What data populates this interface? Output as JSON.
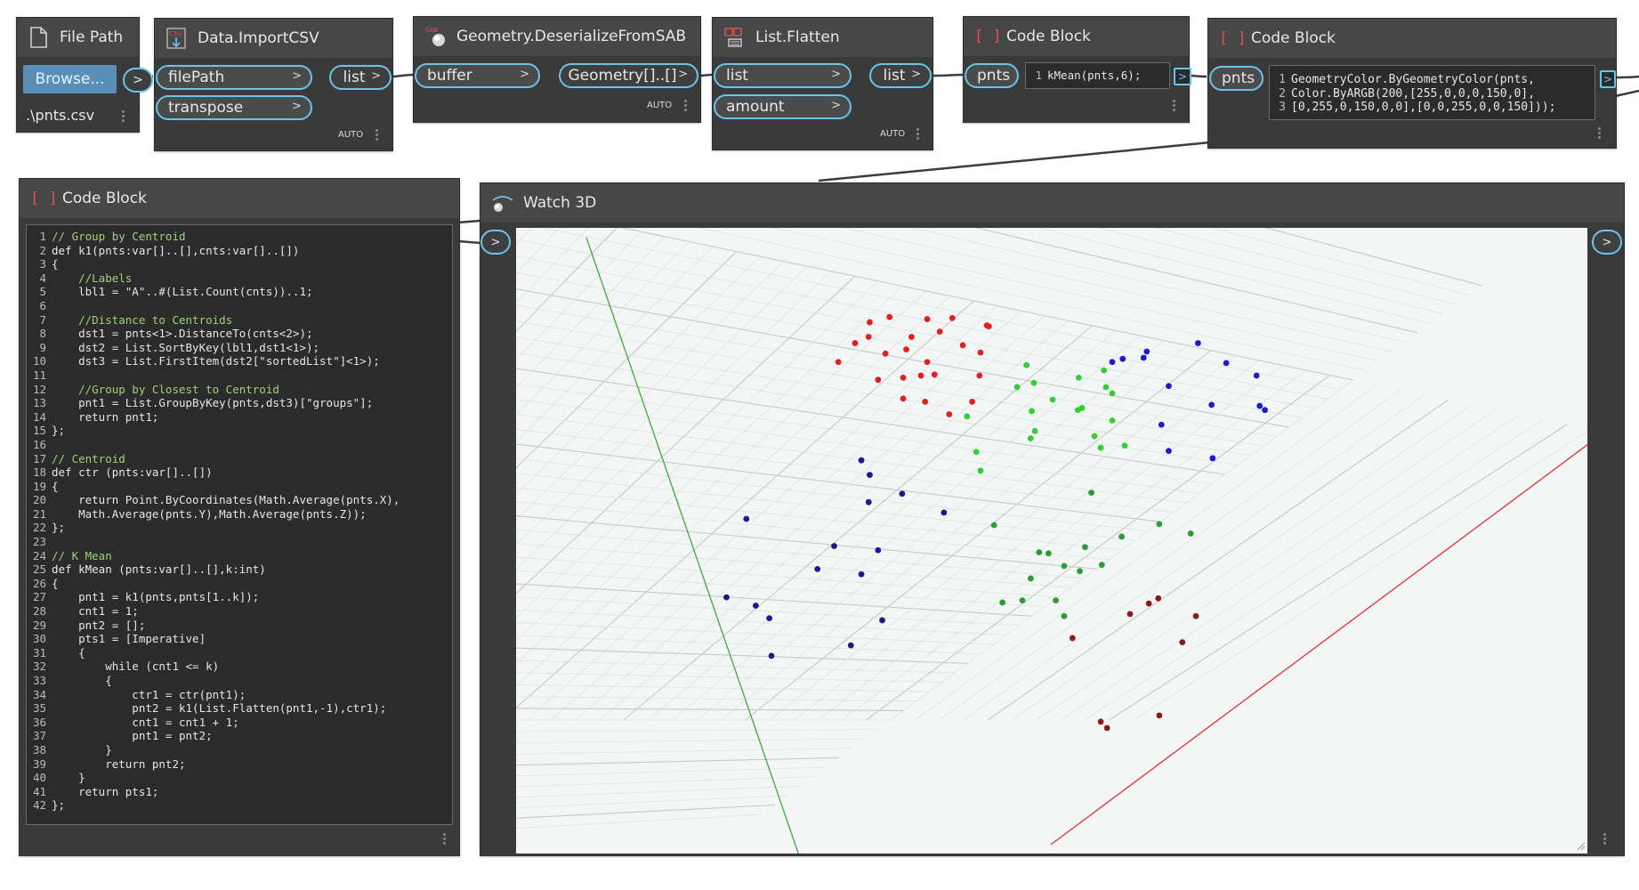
{
  "nodes": {
    "file_path": {
      "title": "File Path",
      "browse_label": "Browse...",
      "out_arrow": ">",
      "value": ".\\pnts.csv"
    },
    "import_csv": {
      "title": "Data.ImportCSV",
      "in_ports": [
        "filePath",
        "transpose"
      ],
      "out_port": "list",
      "lacing": "AUTO"
    },
    "deserialize": {
      "title": "Geometry.DeserializeFromSAB",
      "in_port": "buffer",
      "out_port": "Geometry[]..[]",
      "lacing": "AUTO"
    },
    "flatten": {
      "title": "List.Flatten",
      "in_ports": [
        "list",
        "amount"
      ],
      "out_port": "list",
      "lacing": "AUTO"
    },
    "code_block_small": {
      "title": "Code Block",
      "in_port": "pnts",
      "line_number": "1",
      "code": "kMean(pnts,6);",
      "out_arrow": ">"
    },
    "code_block_color": {
      "title": "Code Block",
      "in_port": "pnts",
      "lines": [
        {
          "n": "1",
          "t": "GeometryColor.ByGeometryColor(pnts,"
        },
        {
          "n": "2",
          "t": "Color.ByARGB(200,[255,0,0,0,150,0],"
        },
        {
          "n": "3",
          "t": "[0,255,0,150,0,0],[0,0,255,0,0,150]));"
        }
      ],
      "out_arrow": ">"
    },
    "code_block_main": {
      "title": "Code Block",
      "lines": [
        {
          "n": "1",
          "t": "// Group by Centroid"
        },
        {
          "n": "2",
          "t": "def k1(pnts:var[]..[],cnts:var[]..[])"
        },
        {
          "n": "3",
          "t": "{"
        },
        {
          "n": "4",
          "t": "    //Labels"
        },
        {
          "n": "5",
          "t": "    lbl1 = \"A\"..#(List.Count(cnts))..1;"
        },
        {
          "n": "6",
          "t": ""
        },
        {
          "n": "7",
          "t": "    //Distance to Centroids"
        },
        {
          "n": "8",
          "t": "    dst1 = pnts<1>.DistanceTo(cnts<2>);"
        },
        {
          "n": "9",
          "t": "    dst2 = List.SortByKey(lbl1,dst1<1>);"
        },
        {
          "n": "10",
          "t": "    dst3 = List.FirstItem(dst2[\"sortedList\"]<1>);"
        },
        {
          "n": "11",
          "t": ""
        },
        {
          "n": "12",
          "t": "    //Group by Closest to Centroid"
        },
        {
          "n": "13",
          "t": "    pnt1 = List.GroupByKey(pnts,dst3)[\"groups\"];"
        },
        {
          "n": "14",
          "t": "    return pnt1;"
        },
        {
          "n": "15",
          "t": "};"
        },
        {
          "n": "16",
          "t": ""
        },
        {
          "n": "17",
          "t": "// Centroid"
        },
        {
          "n": "18",
          "t": "def ctr (pnts:var[]..[])"
        },
        {
          "n": "19",
          "t": "{"
        },
        {
          "n": "20",
          "t": "    return Point.ByCoordinates(Math.Average(pnts.X),"
        },
        {
          "n": "21",
          "t": "    Math.Average(pnts.Y),Math.Average(pnts.Z));"
        },
        {
          "n": "22",
          "t": "};"
        },
        {
          "n": "23",
          "t": ""
        },
        {
          "n": "24",
          "t": "// K Mean"
        },
        {
          "n": "25",
          "t": "def kMean (pnts:var[]..[],k:int)"
        },
        {
          "n": "26",
          "t": "{"
        },
        {
          "n": "27",
          "t": "    pnt1 = k1(pnts,pnts[1..k]);"
        },
        {
          "n": "28",
          "t": "    cnt1 = 1;"
        },
        {
          "n": "29",
          "t": "    pnt2 = [];"
        },
        {
          "n": "30",
          "t": "    pts1 = [Imperative]"
        },
        {
          "n": "31",
          "t": "    {"
        },
        {
          "n": "32",
          "t": "        while (cnt1 <= k)"
        },
        {
          "n": "33",
          "t": "        {"
        },
        {
          "n": "34",
          "t": "            ctr1 = ctr(pnt1);"
        },
        {
          "n": "35",
          "t": "            pnt2 = k1(List.Flatten(pnt1,-1),ctr1);"
        },
        {
          "n": "36",
          "t": "            cnt1 = cnt1 + 1;"
        },
        {
          "n": "37",
          "t": "            pnt1 = pnt2;"
        },
        {
          "n": "38",
          "t": "        }"
        },
        {
          "n": "39",
          "t": "        return pnt2;"
        },
        {
          "n": "40",
          "t": "    }"
        },
        {
          "n": "41",
          "t": "    return pts1;"
        },
        {
          "n": "42",
          "t": "};"
        }
      ]
    },
    "watch3d": {
      "title": "Watch 3D",
      "in_arrow": ">",
      "out_arrow": ">"
    }
  },
  "colors": {
    "canvas": "#ffffff",
    "node_body": "#3a3a3a",
    "node_header": "#474747",
    "port_border": "#6ac4e8",
    "wire": "#3c3c3c",
    "cluster_red": "#e0201f",
    "cluster_green": "#2fd02f",
    "cluster_blue": "#1c1ccc",
    "cluster_dark_green": "#2f9a2f",
    "cluster_dark_blue": "#1a1a8a",
    "cluster_dark_red": "#8a1a1a",
    "x_axis": "#e03030",
    "y_axis": "#3aaa3a"
  },
  "viewport_points": {
    "red": [
      [
        831,
        309
      ],
      [
        850,
        304
      ],
      [
        886,
        306
      ],
      [
        910,
        305
      ],
      [
        943,
        312
      ],
      [
        945,
        313
      ],
      [
        817,
        329
      ],
      [
        830,
        323
      ],
      [
        871,
        323
      ],
      [
        898,
        318
      ],
      [
        920,
        331
      ],
      [
        801,
        347
      ],
      [
        846,
        339
      ],
      [
        866,
        335
      ],
      [
        886,
        347
      ],
      [
        937,
        338
      ],
      [
        839,
        364
      ],
      [
        863,
        362
      ],
      [
        880,
        360
      ],
      [
        893,
        359
      ],
      [
        936,
        360
      ],
      [
        863,
        382
      ],
      [
        884,
        385
      ],
      [
        907,
        397
      ],
      [
        929,
        385
      ]
    ],
    "green": [
      [
        981,
        350
      ],
      [
        972,
        371
      ],
      [
        988,
        367
      ],
      [
        1006,
        383
      ],
      [
        1031,
        362
      ],
      [
        1034,
        391
      ],
      [
        1030,
        393
      ],
      [
        1055,
        355
      ],
      [
        1057,
        371
      ],
      [
        1063,
        377
      ],
      [
        986,
        394
      ],
      [
        924,
        399
      ],
      [
        989,
        413
      ],
      [
        985,
        420
      ],
      [
        1046,
        418
      ],
      [
        1063,
        403
      ],
      [
        1052,
        429
      ],
      [
        1075,
        427
      ],
      [
        933,
        433
      ],
      [
        937,
        451
      ]
    ],
    "blue": [
      [
        1063,
        347
      ],
      [
        1073,
        344
      ],
      [
        1096,
        337
      ],
      [
        1093,
        343
      ],
      [
        1145,
        329
      ],
      [
        1172,
        348
      ],
      [
        1201,
        360
      ],
      [
        1117,
        370
      ],
      [
        1158,
        388
      ],
      [
        1204,
        389
      ],
      [
        1209,
        393
      ],
      [
        1110,
        407
      ],
      [
        1117,
        432
      ],
      [
        1159,
        439
      ]
    ],
    "dark_blue": [
      [
        823,
        441
      ],
      [
        831,
        455
      ],
      [
        862,
        473
      ],
      [
        830,
        481
      ],
      [
        902,
        491
      ],
      [
        713,
        497
      ],
      [
        797,
        523
      ],
      [
        839,
        527
      ],
      [
        781,
        545
      ],
      [
        823,
        550
      ],
      [
        694,
        572
      ],
      [
        722,
        580
      ],
      [
        735,
        592
      ],
      [
        843,
        594
      ],
      [
        813,
        618
      ],
      [
        737,
        628
      ]
    ],
    "dark_green": [
      [
        1043,
        472
      ],
      [
        950,
        503
      ],
      [
        1108,
        502
      ],
      [
        1138,
        511
      ],
      [
        1072,
        514
      ],
      [
        1037,
        524
      ],
      [
        993,
        529
      ],
      [
        1002,
        530
      ],
      [
        1017,
        542
      ],
      [
        1053,
        541
      ],
      [
        1032,
        547
      ],
      [
        985,
        554
      ],
      [
        1009,
        575
      ],
      [
        977,
        575
      ],
      [
        958,
        577
      ],
      [
        1017,
        590
      ]
    ],
    "dark_red": [
      [
        1098,
        578
      ],
      [
        1107,
        573
      ],
      [
        1080,
        588
      ],
      [
        1143,
        590
      ],
      [
        1025,
        611
      ],
      [
        1130,
        615
      ],
      [
        1052,
        691
      ],
      [
        1058,
        697
      ],
      [
        1108,
        685
      ]
    ]
  }
}
